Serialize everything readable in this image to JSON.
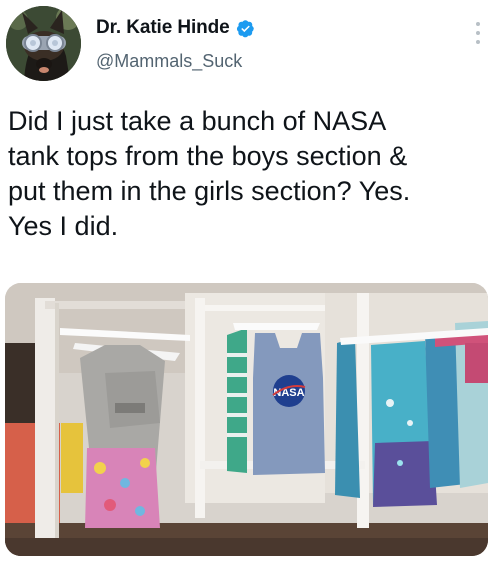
{
  "tweet": {
    "author": {
      "display_name": "Dr. Katie Hinde",
      "handle": "@Mammals_Suck",
      "verified": true,
      "avatar_icon": "dog-with-goggles-avatar"
    },
    "text": "Did I just take a bunch of NASA\ntank tops from the boys section &\nput them in the girls section? Yes.\nYes I did.",
    "media": {
      "description_icon": "clothing-rack-photo",
      "shirt_logo_text": "NASA"
    },
    "menu_icon": "more-options-icon"
  },
  "colors": {
    "verified_blue": "#1d9bf0",
    "text_primary": "#0f1419",
    "text_secondary": "#536471"
  }
}
